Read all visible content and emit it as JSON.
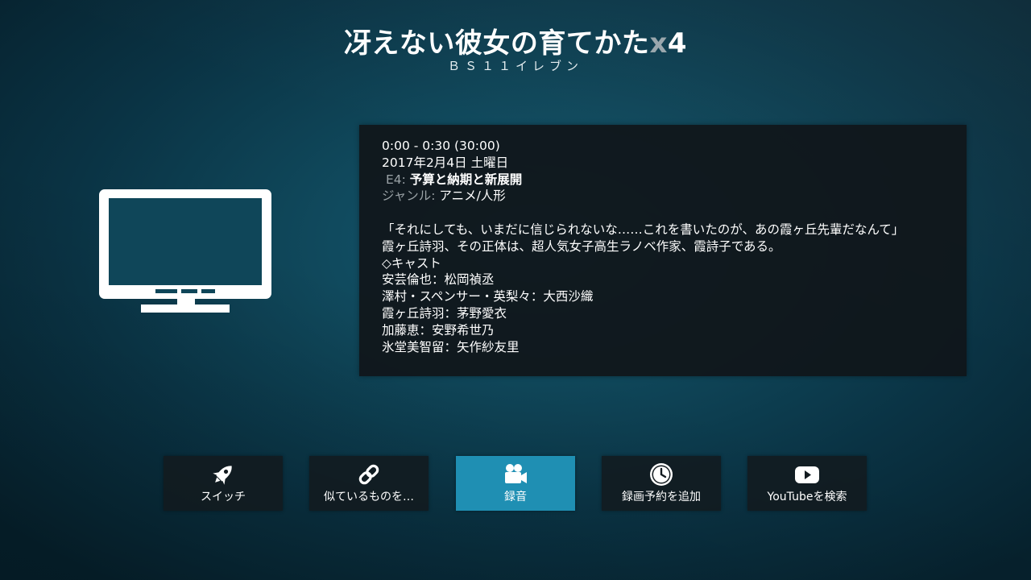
{
  "header": {
    "title_main": "冴えない彼女の育てかた",
    "title_x": "x",
    "title_num": "4",
    "channel": "ＢＳ１１イレブン"
  },
  "info": {
    "time": "0:00 - 0:30 (30:00)",
    "date": "2017年2月4日 土曜日",
    "episode_code": "E4:",
    "episode_title": "予算と納期と新展開",
    "genre_label": "ジャンル:",
    "genre_value": "アニメ/人形",
    "plot": [
      "「それにしても、いまだに信じられないな……これを書いたのが、あの霞ヶ丘先輩だなんて」",
      "霞ヶ丘詩羽、その正体は、超人気女子高生ラノベ作家、霞詩子である。",
      "◇キャスト",
      "安芸倫也：松岡禎丞",
      "澤村・スペンサー・英梨々：大西沙織",
      "霞ヶ丘詩羽：茅野愛衣",
      "加藤恵：安野希世乃",
      "氷堂美智留：矢作紗友里"
    ]
  },
  "icons": {
    "thumbnail": "tv-icon",
    "switch": "rocket-icon",
    "similar": "link-icon",
    "record": "video-camera-icon",
    "timer": "clock-icon",
    "youtube": "youtube-icon"
  },
  "buttons": {
    "switch": "スイッチ",
    "similar": "似ているものを…",
    "record": "録音",
    "add_timer": "録画予約を追加",
    "youtube_search": "YouTubeを検索"
  },
  "colors": {
    "accent": "#1f8fb3",
    "panel": "#10161a",
    "muted_text": "#9aa2a6"
  }
}
